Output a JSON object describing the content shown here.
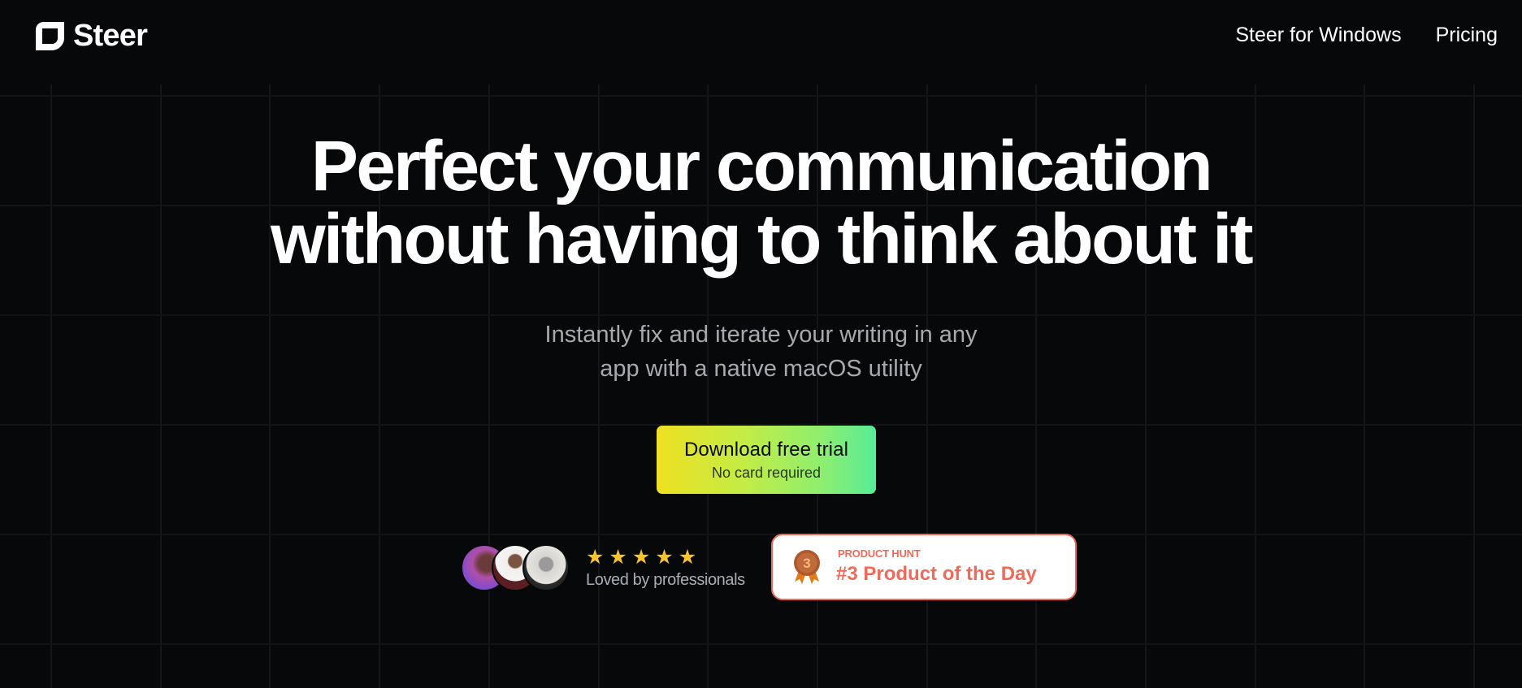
{
  "brand": {
    "name": "Steer",
    "logo_icon": "steer-logo-icon"
  },
  "nav": {
    "items": [
      {
        "label": "Steer for Windows"
      },
      {
        "label": "Pricing"
      }
    ]
  },
  "hero": {
    "title_line_1": "Perfect your communication",
    "title_line_2": "without having to think about it",
    "subtitle_line_1": "Instantly fix and iterate your writing in any",
    "subtitle_line_2": "app with a native macOS utility"
  },
  "cta": {
    "label": "Download free trial",
    "sublabel": "No card required",
    "gradient_start": "#efe021",
    "gradient_end": "#57eb98"
  },
  "social_proof": {
    "avatars": [
      "avatar-1",
      "avatar-2",
      "avatar-3"
    ],
    "rating_stars": 5,
    "rating_max": 5,
    "star_glyph": "★",
    "star_color": "#f8c42e",
    "text": "Loved by professionals"
  },
  "product_hunt": {
    "kicker": "PRODUCT HUNT",
    "title": "#3 Product of the Day",
    "rank": "3",
    "accent": "#f06a5a"
  },
  "colors": {
    "background": "#07080a",
    "grid_line": "#141518",
    "subtitle": "#a9a9ad"
  }
}
